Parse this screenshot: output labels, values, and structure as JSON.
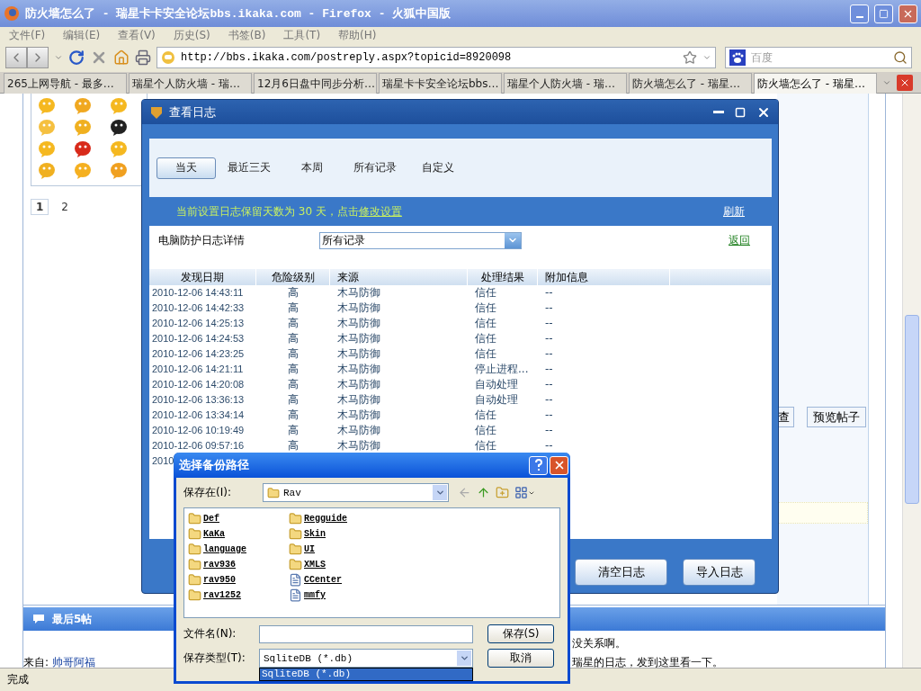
{
  "window": {
    "title": "防火墙怎么了 - 瑞星卡卡安全论坛bbs.ikaka.com - Firefox - 火狐中国版"
  },
  "menu": [
    "文件(F)",
    "编辑(E)",
    "查看(V)",
    "历史(S)",
    "书签(B)",
    "工具(T)",
    "帮助(H)"
  ],
  "address": {
    "value": "http://bbs.ikaka.com/postreply.aspx?topicid=8920098"
  },
  "search": {
    "placeholder": "百度"
  },
  "tabs": [
    {
      "label": "265上网导航 - 最多…",
      "selected": false
    },
    {
      "label": "瑞星个人防火墙 - 瑞…",
      "selected": false
    },
    {
      "label": "12月6日盘中同步分析…",
      "selected": false
    },
    {
      "label": "瑞星卡卡安全论坛bbs…",
      "selected": false
    },
    {
      "label": "瑞星个人防火墙 - 瑞…",
      "selected": false
    },
    {
      "label": "防火墙怎么了 - 瑞星…",
      "selected": false
    },
    {
      "label": "防火墙怎么了 - 瑞星…",
      "selected": true
    }
  ],
  "page": {
    "pagination": [
      {
        "label": "1",
        "selected": true
      },
      {
        "label": "2",
        "selected": false
      }
    ],
    "buttons": [
      "查",
      "预览帖子"
    ],
    "section_title": "最后5帖",
    "author_label": "来自:",
    "author": "帅哥阿福",
    "lines": [
      "没关系啊。",
      "瑞星的日志，发到这里看一下。"
    ]
  },
  "log_dialog": {
    "title": "查看日志",
    "filters": [
      {
        "label": "当天",
        "selected": true
      },
      {
        "label": "最近三天",
        "selected": false
      },
      {
        "label": "本周",
        "selected": false
      },
      {
        "label": "所有记录",
        "selected": false
      },
      {
        "label": "自定义",
        "selected": false
      }
    ],
    "notice": "当前设置日志保留天数为 30 天，点击",
    "notice_link": "修改设置",
    "refresh": "刷新",
    "detail_label": "电脑防护日志详情",
    "detail_select": "所有记录",
    "back": "返回",
    "columns": [
      "发现日期",
      "危险级别",
      "来源",
      "处理结果",
      "附加信息"
    ],
    "rows": [
      {
        "date": "2010-12-06 14:43:11",
        "level": "高",
        "source": "木马防御",
        "result": "信任",
        "extra": "--"
      },
      {
        "date": "2010-12-06 14:42:33",
        "level": "高",
        "source": "木马防御",
        "result": "信任",
        "extra": "--"
      },
      {
        "date": "2010-12-06 14:25:13",
        "level": "高",
        "source": "木马防御",
        "result": "信任",
        "extra": "--"
      },
      {
        "date": "2010-12-06 14:24:53",
        "level": "高",
        "source": "木马防御",
        "result": "信任",
        "extra": "--"
      },
      {
        "date": "2010-12-06 14:23:25",
        "level": "高",
        "source": "木马防御",
        "result": "信任",
        "extra": "--"
      },
      {
        "date": "2010-12-06 14:21:11",
        "level": "高",
        "source": "木马防御",
        "result": "停止进程...",
        "extra": "--"
      },
      {
        "date": "2010-12-06 14:20:08",
        "level": "高",
        "source": "木马防御",
        "result": "自动处理",
        "extra": "--"
      },
      {
        "date": "2010-12-06 13:36:13",
        "level": "高",
        "source": "木马防御",
        "result": "自动处理",
        "extra": "--"
      },
      {
        "date": "2010-12-06 13:34:14",
        "level": "高",
        "source": "木马防御",
        "result": "信任",
        "extra": "--"
      },
      {
        "date": "2010-12-06 10:19:49",
        "level": "高",
        "source": "木马防御",
        "result": "信任",
        "extra": "--"
      },
      {
        "date": "2010-12-06 09:57:16",
        "level": "高",
        "source": "木马防御",
        "result": "信任",
        "extra": "--"
      },
      {
        "date": "2010"
      }
    ],
    "buttons": [
      "清空日志",
      "导入日志"
    ]
  },
  "save_dialog": {
    "title": "选择备份路径",
    "save_in_label": "保存在(I):",
    "folder": "Rav",
    "items": [
      {
        "name": "Def",
        "kind": "folder"
      },
      {
        "name": "KaKa",
        "kind": "folder"
      },
      {
        "name": "language",
        "kind": "folder"
      },
      {
        "name": "rav936",
        "kind": "folder"
      },
      {
        "name": "rav950",
        "kind": "folder"
      },
      {
        "name": "rav1252",
        "kind": "folder"
      },
      {
        "name": "Regguide",
        "kind": "folder"
      },
      {
        "name": "Skin",
        "kind": "folder"
      },
      {
        "name": "UI",
        "kind": "folder"
      },
      {
        "name": "XMLS",
        "kind": "folder"
      },
      {
        "name": "CCenter",
        "kind": "file"
      },
      {
        "name": "mmfy",
        "kind": "file"
      }
    ],
    "filename_label": "文件名(N):",
    "type_label": "保存类型(T):",
    "type_value": "SqliteDB (*.db)",
    "type_options": [
      {
        "label": "SqliteDB (*.db)",
        "selected": true
      }
    ],
    "buttons": [
      "保存(S)",
      "取消"
    ]
  },
  "status_bar": "完成"
}
